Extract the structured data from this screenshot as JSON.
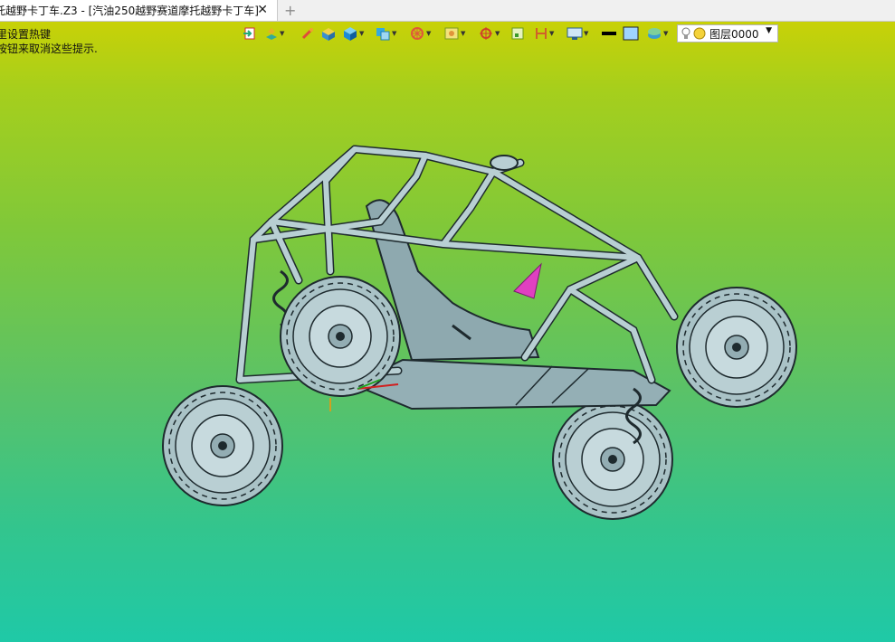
{
  "tab": {
    "title": "托越野卡丁车.Z3 - [汽油250越野赛道摩托越野卡丁车]",
    "close_glyph": "✕",
    "add_glyph": "+"
  },
  "hints": {
    "line1": "里设置热键",
    "line2": "按钮来取消这些提示."
  },
  "toolbar": {
    "icons": [
      "import-icon",
      "layer-manager-icon",
      "brush-icon",
      "material-icon",
      "solid-view-icon",
      "shaded-view-icon",
      "wheel-view-icon",
      "frame-icon",
      "target-icon",
      "snap-grid-icon",
      "dimension-icon",
      "monitor-display-icon",
      "line-color-icon",
      "fill-color-icon",
      "layers-icon",
      "light-bulb-icon"
    ]
  },
  "layer_select": {
    "value": "图层0000",
    "arrow": "▼"
  },
  "model": {
    "name": "off-road kart",
    "colors": {
      "frame": "#b8cfd3",
      "frame_edge": "#1e2a2e",
      "tire": "#a9c2c6",
      "floor": "#94afb5",
      "accent_magenta": "#e040c0"
    }
  }
}
